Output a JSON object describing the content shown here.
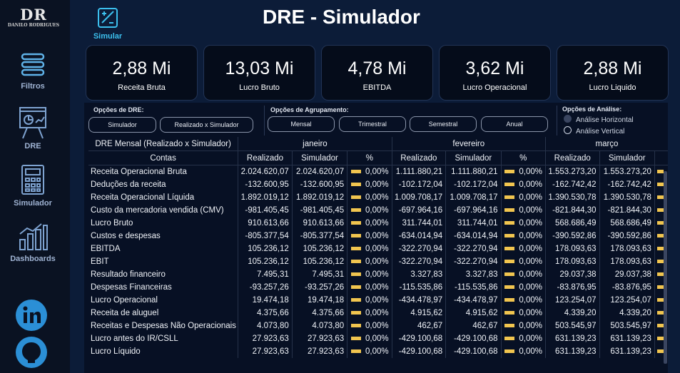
{
  "logo": {
    "initials": "DR",
    "name": "DANILO RODRIGUES"
  },
  "nav": [
    {
      "label": "Filtros",
      "icon": "filter-icon"
    },
    {
      "label": "DRE",
      "icon": "presentation-icon"
    },
    {
      "label": "Simulador",
      "icon": "calculator-icon"
    },
    {
      "label": "Dashboards",
      "icon": "bar-chart-icon"
    }
  ],
  "social": [
    {
      "icon": "linkedin-icon"
    },
    {
      "icon": "github-icon"
    }
  ],
  "header": {
    "title": "DRE - Simulador",
    "simular_label": "Simular"
  },
  "kpis": [
    {
      "value": "2,88 Mi",
      "label": "Receita Bruta"
    },
    {
      "value": "13,03 Mi",
      "label": "Lucro Bruto"
    },
    {
      "value": "4,78 Mi",
      "label": "EBITDA"
    },
    {
      "value": "3,62 Mi",
      "label": "Lucro Operacional"
    },
    {
      "value": "2,88 Mi",
      "label": "Lucro Liquido"
    }
  ],
  "options": {
    "dre_label": "Opções de DRE:",
    "dre_buttons": [
      "Simulador",
      "Realizado x Simulador"
    ],
    "group_label": "Opções de Agrupamento:",
    "group_buttons": [
      "Mensal",
      "Trimestral",
      "Semestral",
      "Anual"
    ],
    "analysis_label": "Opções de Análise:",
    "analysis_radios": [
      "Análise Horizontal",
      "Análise Vertical"
    ]
  },
  "table": {
    "title": "DRE Mensal (Realizado x Simulador)",
    "accounts_header": "Contas",
    "months": [
      "janeiro",
      "fevereiro",
      "março"
    ],
    "sub_headers": [
      "Realizado",
      "Simulador",
      "%"
    ],
    "rows": [
      {
        "conta": "Receita Operacional Bruta",
        "m": [
          [
            "2.024.620,07",
            "2.024.620,07",
            "0,00%"
          ],
          [
            "1.111.880,21",
            "1.111.880,21",
            "0,00%"
          ],
          [
            "1.553.273,20",
            "1.553.273,20"
          ]
        ]
      },
      {
        "conta": "Deduções da receita",
        "m": [
          [
            "-132.600,95",
            "-132.600,95",
            "0,00%"
          ],
          [
            "-102.172,04",
            "-102.172,04",
            "0,00%"
          ],
          [
            "-162.742,42",
            "-162.742,42"
          ]
        ]
      },
      {
        "conta": "Receita Operacional Líquida",
        "m": [
          [
            "1.892.019,12",
            "1.892.019,12",
            "0,00%"
          ],
          [
            "1.009.708,17",
            "1.009.708,17",
            "0,00%"
          ],
          [
            "1.390.530,78",
            "1.390.530,78"
          ]
        ]
      },
      {
        "conta": "Custo da mercadoria vendida (CMV)",
        "m": [
          [
            "-981.405,45",
            "-981.405,45",
            "0,00%"
          ],
          [
            "-697.964,16",
            "-697.964,16",
            "0,00%"
          ],
          [
            "-821.844,30",
            "-821.844,30"
          ]
        ]
      },
      {
        "conta": "Lucro Bruto",
        "m": [
          [
            "910.613,66",
            "910.613,66",
            "0,00%"
          ],
          [
            "311.744,01",
            "311.744,01",
            "0,00%"
          ],
          [
            "568.686,49",
            "568.686,49"
          ]
        ]
      },
      {
        "conta": "Custos e despesas",
        "m": [
          [
            "-805.377,54",
            "-805.377,54",
            "0,00%"
          ],
          [
            "-634.014,94",
            "-634.014,94",
            "0,00%"
          ],
          [
            "-390.592,86",
            "-390.592,86"
          ]
        ]
      },
      {
        "conta": "EBITDA",
        "m": [
          [
            "105.236,12",
            "105.236,12",
            "0,00%"
          ],
          [
            "-322.270,94",
            "-322.270,94",
            "0,00%"
          ],
          [
            "178.093,63",
            "178.093,63"
          ]
        ]
      },
      {
        "conta": "EBIT",
        "m": [
          [
            "105.236,12",
            "105.236,12",
            "0,00%"
          ],
          [
            "-322.270,94",
            "-322.270,94",
            "0,00%"
          ],
          [
            "178.093,63",
            "178.093,63"
          ]
        ]
      },
      {
        "conta": "Resultado financeiro",
        "m": [
          [
            "7.495,31",
            "7.495,31",
            "0,00%"
          ],
          [
            "3.327,83",
            "3.327,83",
            "0,00%"
          ],
          [
            "29.037,38",
            "29.037,38"
          ]
        ]
      },
      {
        "conta": "Despesas Financeiras",
        "m": [
          [
            "-93.257,26",
            "-93.257,26",
            "0,00%"
          ],
          [
            "-115.535,86",
            "-115.535,86",
            "0,00%"
          ],
          [
            "-83.876,95",
            "-83.876,95"
          ]
        ]
      },
      {
        "conta": "Lucro Operacional",
        "m": [
          [
            "19.474,18",
            "19.474,18",
            "0,00%"
          ],
          [
            "-434.478,97",
            "-434.478,97",
            "0,00%"
          ],
          [
            "123.254,07",
            "123.254,07"
          ]
        ]
      },
      {
        "conta": "Receita de aluguel",
        "m": [
          [
            "4.375,66",
            "4.375,66",
            "0,00%"
          ],
          [
            "4.915,62",
            "4.915,62",
            "0,00%"
          ],
          [
            "4.339,20",
            "4.339,20"
          ]
        ]
      },
      {
        "conta": "Receitas e Despesas Não Operacionais",
        "m": [
          [
            "4.073,80",
            "4.073,80",
            "0,00%"
          ],
          [
            "462,67",
            "462,67",
            "0,00%"
          ],
          [
            "503.545,97",
            "503.545,97"
          ]
        ]
      },
      {
        "conta": "Lucro antes do IR/CSLL",
        "m": [
          [
            "27.923,63",
            "27.923,63",
            "0,00%"
          ],
          [
            "-429.100,68",
            "-429.100,68",
            "0,00%"
          ],
          [
            "631.139,23",
            "631.139,23"
          ]
        ]
      },
      {
        "conta": "Lucro Líquido",
        "m": [
          [
            "27.923,63",
            "27.923,63",
            "0,00%"
          ],
          [
            "-429.100,68",
            "-429.100,68",
            "0,00%"
          ],
          [
            "631.139,23",
            "631.139,23"
          ]
        ]
      }
    ]
  },
  "colors": {
    "accent": "#3cc0ee",
    "bar": "#f1c54f",
    "background": "#0c1c38"
  }
}
